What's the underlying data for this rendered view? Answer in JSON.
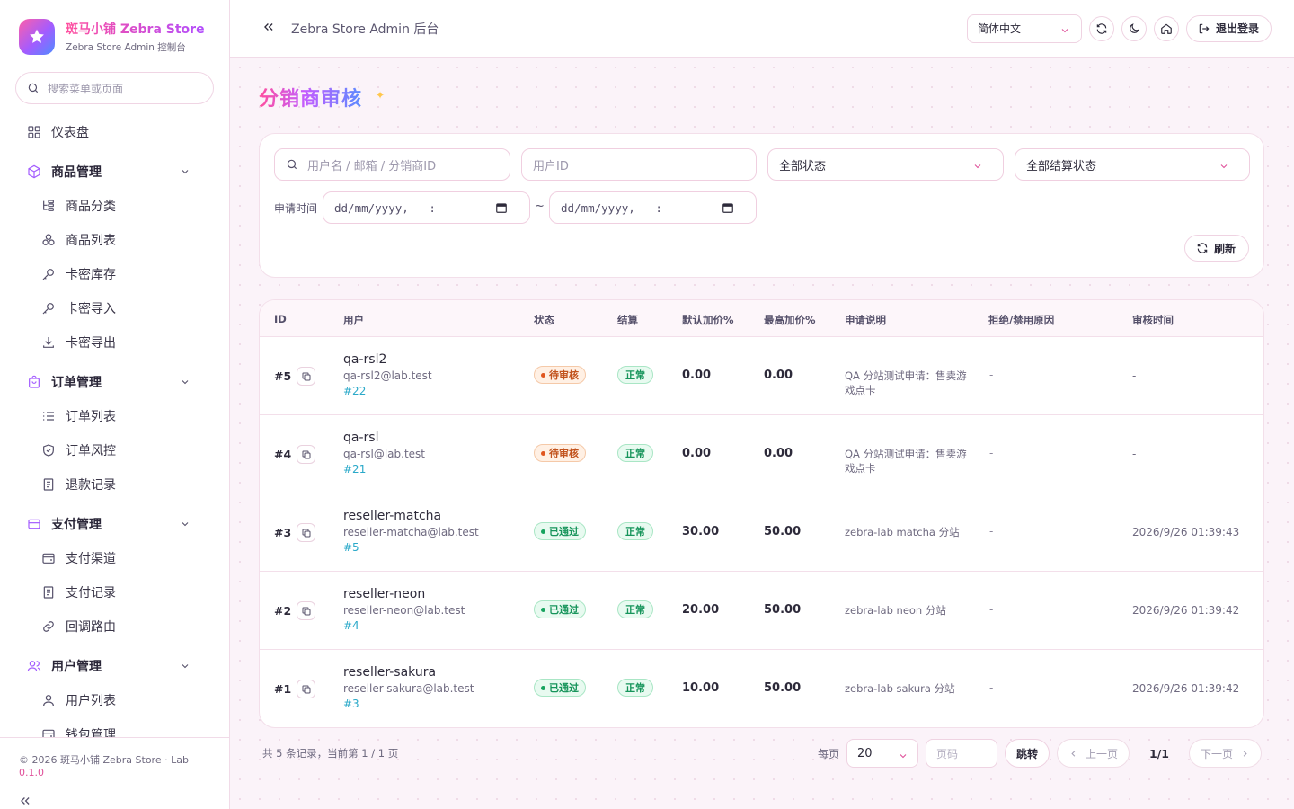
{
  "brand": {
    "title": "斑马小铺 Zebra Store",
    "subtitle": "Zebra Store Admin 控制台",
    "accent": "#ff4f9e"
  },
  "sidebar": {
    "search_placeholder": "搜索菜单或页面",
    "dashboard": "仪表盘",
    "groups": [
      {
        "label": "商品管理",
        "icon": "cube-icon",
        "items": [
          {
            "label": "商品分类",
            "icon": "tree-icon"
          },
          {
            "label": "商品列表",
            "icon": "boxes-icon"
          },
          {
            "label": "卡密库存",
            "icon": "key-icon"
          },
          {
            "label": "卡密导入",
            "icon": "key-icon"
          },
          {
            "label": "卡密导出",
            "icon": "download-icon"
          }
        ]
      },
      {
        "label": "订单管理",
        "icon": "bag-icon",
        "items": [
          {
            "label": "订单列表",
            "icon": "list-icon"
          },
          {
            "label": "订单风控",
            "icon": "shield-icon"
          },
          {
            "label": "退款记录",
            "icon": "receipt-icon"
          }
        ]
      },
      {
        "label": "支付管理",
        "icon": "card-icon",
        "items": [
          {
            "label": "支付渠道",
            "icon": "wallet-icon"
          },
          {
            "label": "支付记录",
            "icon": "receipt-icon"
          },
          {
            "label": "回调路由",
            "icon": "link-icon"
          }
        ]
      },
      {
        "label": "用户管理",
        "icon": "users-icon",
        "items": [
          {
            "label": "用户列表",
            "icon": "user-icon"
          },
          {
            "label": "钱包管理",
            "icon": "wallet-icon"
          }
        ]
      }
    ],
    "footer": {
      "copyright": "© 2026 斑马小铺 Zebra Store · Lab ",
      "version": "0.1.0"
    }
  },
  "header": {
    "title": "Zebra Store Admin 后台",
    "language": "简体中文",
    "logout": "退出登录"
  },
  "page": {
    "title": "分销商审核"
  },
  "filters": {
    "keyword_placeholder": "用户名 / 邮箱 / 分销商ID",
    "user_id_placeholder": "用户ID",
    "status": "全部状态",
    "settle_status": "全部结算状态",
    "time_label": "申请时间",
    "date_start": "dd/mm/yyyy, --:-- --",
    "date_end": "dd/mm/yyyy, --:-- --",
    "tilde": "~",
    "refresh": "刷新"
  },
  "table": {
    "columns": [
      "ID",
      "用户",
      "状态",
      "结算",
      "默认加价%",
      "最高加价%",
      "申请说明",
      "拒绝/禁用原因",
      "审核时间"
    ],
    "rows": [
      {
        "id": "#5",
        "name": "qa-rsl2",
        "email": "qa-rsl2@lab.test",
        "uid": "#22",
        "status": "待审核",
        "status_kind": "pending",
        "settle": "正常",
        "default_markup": "0.00",
        "max_markup": "0.00",
        "desc": "QA 分站测试申请：售卖游戏点卡",
        "reason": "-",
        "time": "-"
      },
      {
        "id": "#4",
        "name": "qa-rsl",
        "email": "qa-rsl@lab.test",
        "uid": "#21",
        "status": "待审核",
        "status_kind": "pending",
        "settle": "正常",
        "default_markup": "0.00",
        "max_markup": "0.00",
        "desc": "QA 分站测试申请：售卖游戏点卡",
        "reason": "-",
        "time": "-"
      },
      {
        "id": "#3",
        "name": "reseller-matcha",
        "email": "reseller-matcha@lab.test",
        "uid": "#5",
        "status": "已通过",
        "status_kind": "approved",
        "settle": "正常",
        "default_markup": "30.00",
        "max_markup": "50.00",
        "desc": "zebra-lab matcha 分站",
        "reason": "-",
        "time": "2026/9/26 01:39:43"
      },
      {
        "id": "#2",
        "name": "reseller-neon",
        "email": "reseller-neon@lab.test",
        "uid": "#4",
        "status": "已通过",
        "status_kind": "approved",
        "settle": "正常",
        "default_markup": "20.00",
        "max_markup": "50.00",
        "desc": "zebra-lab neon 分站",
        "reason": "-",
        "time": "2026/9/26 01:39:42"
      },
      {
        "id": "#1",
        "name": "reseller-sakura",
        "email": "reseller-sakura@lab.test",
        "uid": "#3",
        "status": "已通过",
        "status_kind": "approved",
        "settle": "正常",
        "default_markup": "10.00",
        "max_markup": "50.00",
        "desc": "zebra-lab sakura 分站",
        "reason": "-",
        "time": "2026/9/26 01:39:42"
      }
    ]
  },
  "pager": {
    "summary": "共 5 条记录，当前第 1 / 1 页",
    "per_page_label": "每页",
    "per_page": "20",
    "page_placeholder": "页码",
    "jump": "跳转",
    "prev": "上一页",
    "current": "1/1",
    "next": "下一页"
  }
}
